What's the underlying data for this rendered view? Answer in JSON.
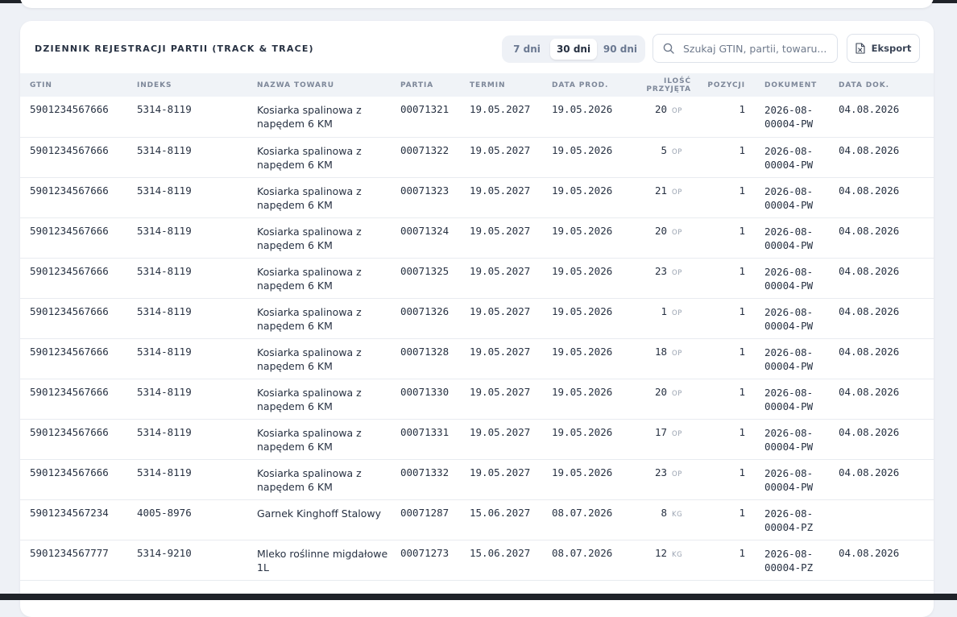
{
  "panel": {
    "title": "DZIENNIK REJESTRACJI PARTII (TRACK & TRACE)",
    "ranges": [
      {
        "label": "7 dni",
        "active": false
      },
      {
        "label": "30 dni",
        "active": true
      },
      {
        "label": "90 dni",
        "active": false
      }
    ],
    "search_placeholder": "Szukaj GTIN, partii, towaru...",
    "export_label": "Eksport"
  },
  "table": {
    "columns": [
      "GTIN",
      "INDEKS",
      "NAZWA TOWARU",
      "PARTIA",
      "TERMIN",
      "DATA PROD.",
      "ILOŚĆ PRZYJĘTA",
      "POZYCJI",
      "DOKUMENT",
      "DATA DOK."
    ],
    "rows": [
      {
        "gtin": "5901234567666",
        "index": "5314-8119",
        "name": "Kosiarka spalinowa z napędem 6 KM",
        "batch": "00071321",
        "expiry": "19.05.2027",
        "prod": "19.05.2026",
        "qty": "20",
        "unit": "OP",
        "pos": "1",
        "doc": "2026-08-00004-PW",
        "doc_date": "04.08.2026"
      },
      {
        "gtin": "5901234567666",
        "index": "5314-8119",
        "name": "Kosiarka spalinowa z napędem 6 KM",
        "batch": "00071322",
        "expiry": "19.05.2027",
        "prod": "19.05.2026",
        "qty": "5",
        "unit": "OP",
        "pos": "1",
        "doc": "2026-08-00004-PW",
        "doc_date": "04.08.2026"
      },
      {
        "gtin": "5901234567666",
        "index": "5314-8119",
        "name": "Kosiarka spalinowa z napędem 6 KM",
        "batch": "00071323",
        "expiry": "19.05.2027",
        "prod": "19.05.2026",
        "qty": "21",
        "unit": "OP",
        "pos": "1",
        "doc": "2026-08-00004-PW",
        "doc_date": "04.08.2026"
      },
      {
        "gtin": "5901234567666",
        "index": "5314-8119",
        "name": "Kosiarka spalinowa z napędem 6 KM",
        "batch": "00071324",
        "expiry": "19.05.2027",
        "prod": "19.05.2026",
        "qty": "20",
        "unit": "OP",
        "pos": "1",
        "doc": "2026-08-00004-PW",
        "doc_date": "04.08.2026"
      },
      {
        "gtin": "5901234567666",
        "index": "5314-8119",
        "name": "Kosiarka spalinowa z napędem 6 KM",
        "batch": "00071325",
        "expiry": "19.05.2027",
        "prod": "19.05.2026",
        "qty": "23",
        "unit": "OP",
        "pos": "1",
        "doc": "2026-08-00004-PW",
        "doc_date": "04.08.2026"
      },
      {
        "gtin": "5901234567666",
        "index": "5314-8119",
        "name": "Kosiarka spalinowa z napędem 6 KM",
        "batch": "00071326",
        "expiry": "19.05.2027",
        "prod": "19.05.2026",
        "qty": "1",
        "unit": "OP",
        "pos": "1",
        "doc": "2026-08-00004-PW",
        "doc_date": "04.08.2026"
      },
      {
        "gtin": "5901234567666",
        "index": "5314-8119",
        "name": "Kosiarka spalinowa z napędem 6 KM",
        "batch": "00071328",
        "expiry": "19.05.2027",
        "prod": "19.05.2026",
        "qty": "18",
        "unit": "OP",
        "pos": "1",
        "doc": "2026-08-00004-PW",
        "doc_date": "04.08.2026"
      },
      {
        "gtin": "5901234567666",
        "index": "5314-8119",
        "name": "Kosiarka spalinowa z napędem 6 KM",
        "batch": "00071330",
        "expiry": "19.05.2027",
        "prod": "19.05.2026",
        "qty": "20",
        "unit": "OP",
        "pos": "1",
        "doc": "2026-08-00004-PW",
        "doc_date": "04.08.2026"
      },
      {
        "gtin": "5901234567666",
        "index": "5314-8119",
        "name": "Kosiarka spalinowa z napędem 6 KM",
        "batch": "00071331",
        "expiry": "19.05.2027",
        "prod": "19.05.2026",
        "qty": "17",
        "unit": "OP",
        "pos": "1",
        "doc": "2026-08-00004-PW",
        "doc_date": "04.08.2026"
      },
      {
        "gtin": "5901234567666",
        "index": "5314-8119",
        "name": "Kosiarka spalinowa z napędem 6 KM",
        "batch": "00071332",
        "expiry": "19.05.2027",
        "prod": "19.05.2026",
        "qty": "23",
        "unit": "OP",
        "pos": "1",
        "doc": "2026-08-00004-PW",
        "doc_date": "04.08.2026"
      },
      {
        "gtin": "5901234567234",
        "index": "4005-8976",
        "name": "Garnek Kinghoff Stalowy",
        "batch": "00071287",
        "expiry": "15.06.2027",
        "prod": "08.07.2026",
        "qty": "8",
        "unit": "KG",
        "pos": "1",
        "doc": "2026-08-00004-PZ",
        "doc_date": ""
      },
      {
        "gtin": "5901234567777",
        "index": "5314-9210",
        "name": "Mleko roślinne migdałowe 1L",
        "batch": "00071273",
        "expiry": "15.06.2027",
        "prod": "08.07.2026",
        "qty": "12",
        "unit": "KG",
        "pos": "1",
        "doc": "2026-08-00004-PZ",
        "doc_date": "04.08.2026"
      }
    ]
  }
}
